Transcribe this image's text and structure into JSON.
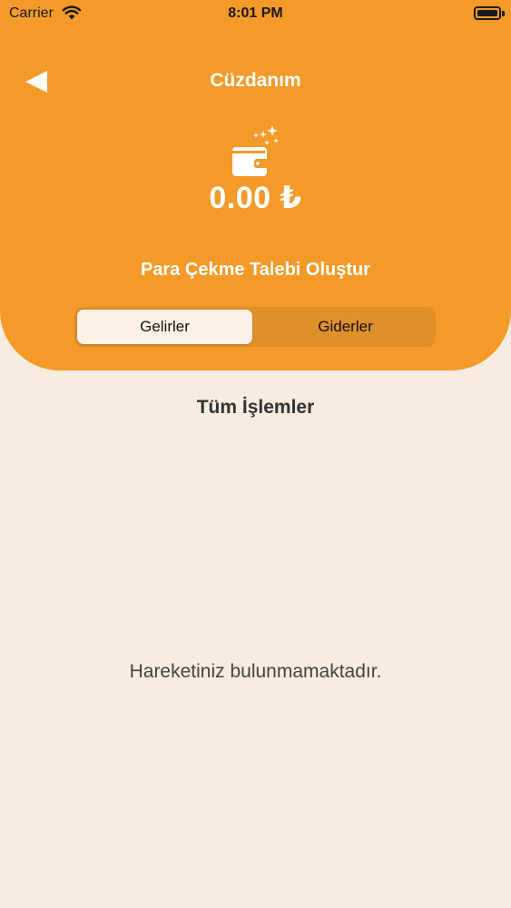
{
  "status_bar": {
    "carrier": "Carrier",
    "time": "8:01 PM"
  },
  "nav": {
    "title": "Cüzdanım",
    "back_icon": "back-arrow-icon"
  },
  "wallet": {
    "icon": "wallet-sparkle-icon",
    "balance": "0.00 ₺",
    "withdraw_label": "Para Çekme Talebi Oluştur"
  },
  "tabs": [
    {
      "label": "Gelirler",
      "selected": true
    },
    {
      "label": "Giderler",
      "selected": false
    }
  ],
  "section": {
    "title": "Tüm İşlemler",
    "empty_message": "Hareketiniz bulunmamaktadır."
  },
  "colors": {
    "accent": "#f39a28",
    "background": "#f7ecdf",
    "segment_track": "#e0902a",
    "segment_selected": "#fbf1e4"
  }
}
